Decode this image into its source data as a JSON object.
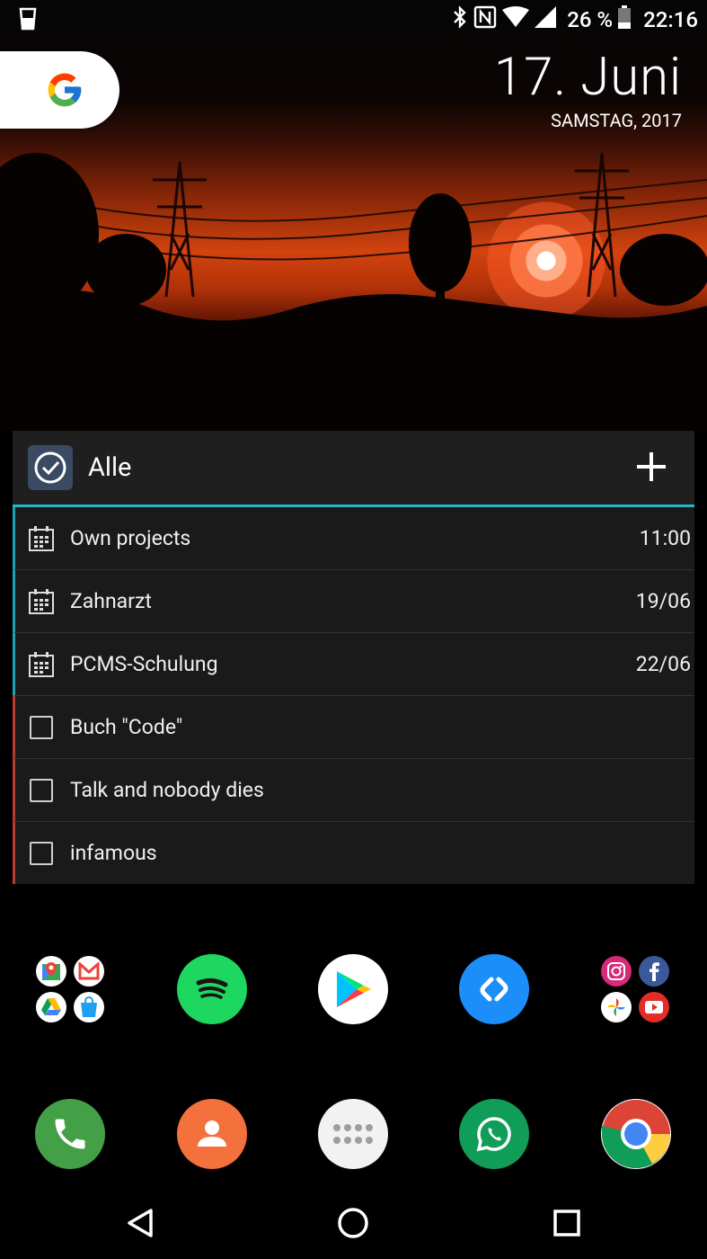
{
  "status_bar": {
    "battery_percent": "26 %",
    "time": "22:16"
  },
  "wallpaper_date": {
    "day_month": "17. Juni",
    "weekday_year": "SAMSTAG, 2017"
  },
  "widget": {
    "title": "Alle",
    "items": [
      {
        "type": "calendar",
        "label": "Own projects",
        "when": "11:00"
      },
      {
        "type": "calendar",
        "label": "Zahnarzt",
        "when": "19/06"
      },
      {
        "type": "calendar",
        "label": "PCMS-Schulung",
        "when": "22/06"
      },
      {
        "type": "task",
        "label": "Buch \"Code\"",
        "when": ""
      },
      {
        "type": "task",
        "label": "Talk and nobody dies",
        "when": ""
      },
      {
        "type": "task",
        "label": "infamous",
        "when": ""
      }
    ]
  },
  "apps_row": [
    "google-folder",
    "spotify",
    "play-store",
    "shazam",
    "social-folder"
  ],
  "dock": [
    "phone",
    "contacts",
    "app-drawer",
    "whatsapp",
    "chrome"
  ],
  "colors": {
    "calendar_accent": "#1fa2b4",
    "task_accent": "#b83a33",
    "header_underline": "#26b6c9",
    "widget_bg": "#1d1d1d"
  }
}
